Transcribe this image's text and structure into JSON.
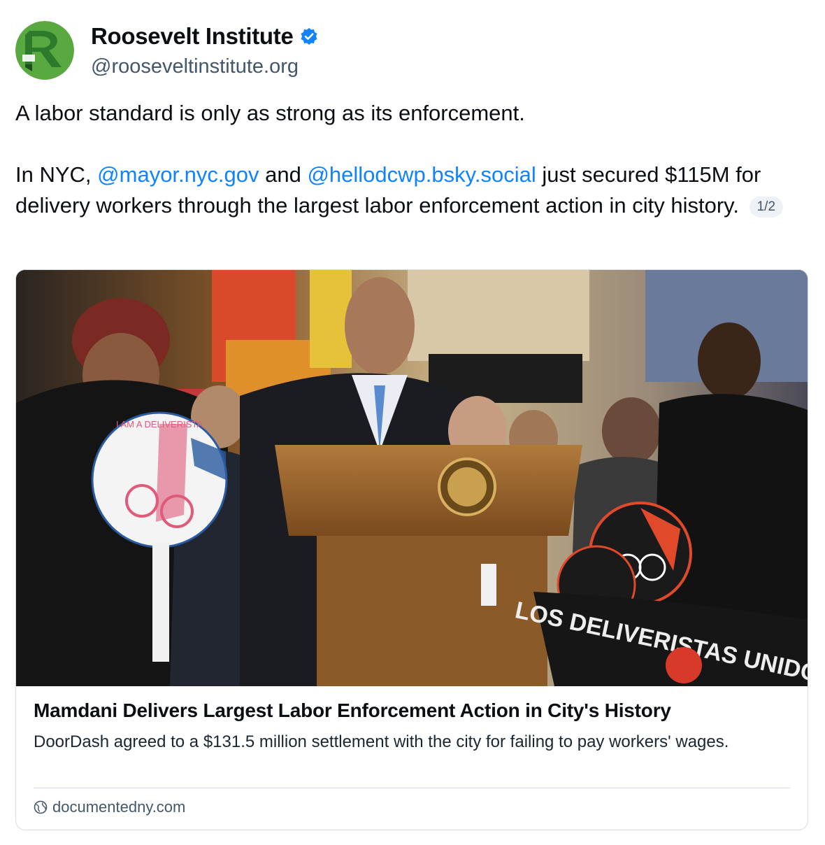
{
  "author": {
    "display_name": "Roosevelt Institute",
    "handle": "@rooseveltinstitute.org",
    "avatar_icon": "roosevelt-logo",
    "verified_icon": "verified-check-icon",
    "verified_color": "#1083fe"
  },
  "post": {
    "line1": "A labor standard is only as strong as its enforcement.",
    "p2_start": "In NYC, ",
    "mention1": "@mayor.nyc.gov",
    "p2_and": " and ",
    "mention2": "@hellodcwp.bsky.social",
    "p2_rest": " just secured $115M for delivery workers through the largest labor enforcement action in city history.",
    "thread_badge": "1/2"
  },
  "link_card": {
    "image_alt": "Press conference at a podium with delivery workers holding signs",
    "sign_text": "I AM A DELIVERISTA",
    "banner_text": "LOS DELIVERISTAS UNIDOS",
    "title": "Mamdani Delivers Largest Labor Enforcement Action in City's History",
    "description": "DoorDash agreed to a $131.5 million settlement with the city for failing to pay workers' wages.",
    "domain": "documentedny.com",
    "domain_icon": "globe-icon"
  },
  "colors": {
    "mention": "#1083fe",
    "handle": "#42576c",
    "border": "#d4dbe2"
  }
}
